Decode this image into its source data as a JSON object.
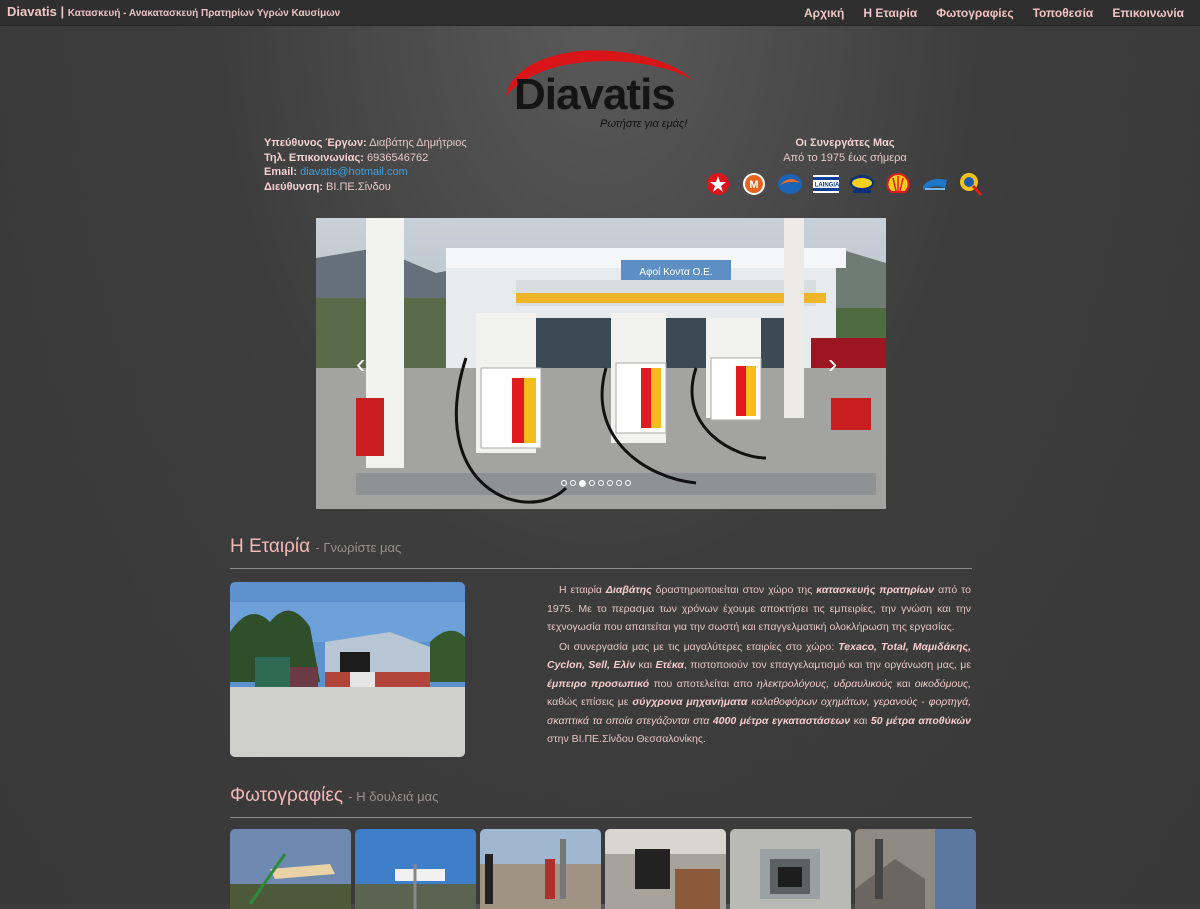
{
  "header": {
    "brand": "Diavatis",
    "separator": "|",
    "tagline": "Κατασκευή - Ανακατασκευή Πρατηρίων Υγρών Καυσίμων",
    "nav": [
      "Αρχική",
      "Η Εταιρία",
      "Φωτογραφίες",
      "Τοποθεσία",
      "Επικοινωνία"
    ]
  },
  "logo": {
    "word": "Diavatis",
    "slogan": "Ρωτήστε για εμάς!"
  },
  "contact": {
    "manager_label": "Υπεύθυνος Έργων:",
    "manager_value": "Διαβάτης Δημήτριος",
    "phone_label": "Τηλ. Επικοινωνίας:",
    "phone_value": "6936546762",
    "email_label": "Email:",
    "email_value": "diavatis@hotmail.com",
    "address_label": "Διεύθυνση:",
    "address_value": "ΒΙ.ΠΕ.Σίνδου"
  },
  "partners": {
    "title": "Οι Συνεργάτες Μας",
    "subtitle": "Από το 1975 έως σήμερα",
    "logos": [
      "texaco-logo",
      "mamidakis-logo",
      "cyclon-logo",
      "laingia-logo",
      "elin-logo",
      "shell-logo",
      "eteka-logo",
      "q-logo"
    ]
  },
  "slider": {
    "sign_text": "Αφοί Κοντα Ο.Ε.",
    "slide_count": 8,
    "active_index": 2
  },
  "company": {
    "title": "Η Εταιρία",
    "subtitle": "- Γνωρίστε μας",
    "p1_a": "Η εταιρία ",
    "p1_b": "Διαβάτης",
    "p1_c": " δραστηριοποιείται στον χώρο της ",
    "p1_d": "κατασκευής πρατηρίων",
    "p1_e": " από το 1975. Με το περασμα των χρόνων έχουμε αποκτήσει τις εμπειρίες, την γνώση και την τεχνογωσία που απαιτείται για την σωστή και επαγγελματική ολοκλήρωση της εργασίας.",
    "p2_a": "Οι συνεργασία μας με τις μαγαλύτερες εταιρίες στο χώρο: ",
    "p2_b": "Texaco, Total, Μαμιδάκης, Cyclon, Sell, Ελίν",
    "p2_c": " και ",
    "p2_d": "Ετέκα",
    "p2_e": ", πιστοποιούν τον επαγγελαμτισμό και την οργάνωση μας, με ",
    "p2_f": "έμπειρο προσωπικό",
    "p2_g": " που αποτελείται απο ",
    "p2_h": "ηλεκτρολόγους, υδραυλικούς",
    "p2_i": " και ",
    "p2_j": "οικοδόμους,",
    "p2_k": " καθώς επίσεις με ",
    "p2_l": "σύγχρονα μηχανήματα",
    "p2_m": " καλαθοφόρων οχημάτων, γερανούς - φορτηγά, σκαπτικά τα οποία στεγάζονται στα ",
    "p2_n": "4000 μέτρα εγκαταστάσεων",
    "p2_o": " και ",
    "p2_p": "50 μέτρα αποθύκών",
    "p2_q": " στην ΒΙ.ΠΕ.Σίνδου Θεσσαλονίκης."
  },
  "photos": {
    "title": "Φωτογραφίες",
    "subtitle": "- Η δουλειά μας"
  },
  "colors": {
    "accent_pink": "#f2b9b9",
    "link_blue": "#3fa0e0",
    "topbar": "#2f2f2f",
    "logo_red": "#d9151a"
  }
}
